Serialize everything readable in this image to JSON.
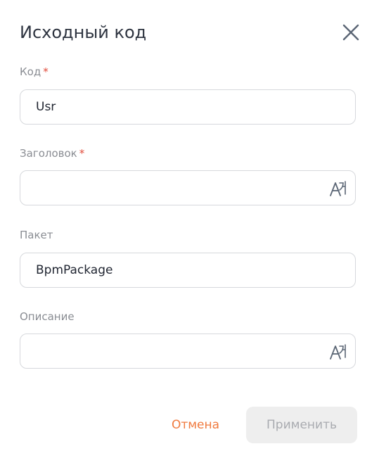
{
  "dialog": {
    "title": "Исходный код",
    "close_icon": "close-icon"
  },
  "fields": {
    "code": {
      "label": "Код",
      "required_mark": "*",
      "value": "Usr"
    },
    "caption": {
      "label": "Заголовок",
      "required_mark": "*",
      "value": "",
      "icon": "translate-icon"
    },
    "package": {
      "label": "Пакет",
      "value": "BpmPackage"
    },
    "description": {
      "label": "Описание",
      "value": "",
      "icon": "translate-icon"
    }
  },
  "actions": {
    "cancel_label": "Отмена",
    "apply_label": "Применить",
    "cancel_color": "#f07a3e",
    "apply_enabled": false
  }
}
